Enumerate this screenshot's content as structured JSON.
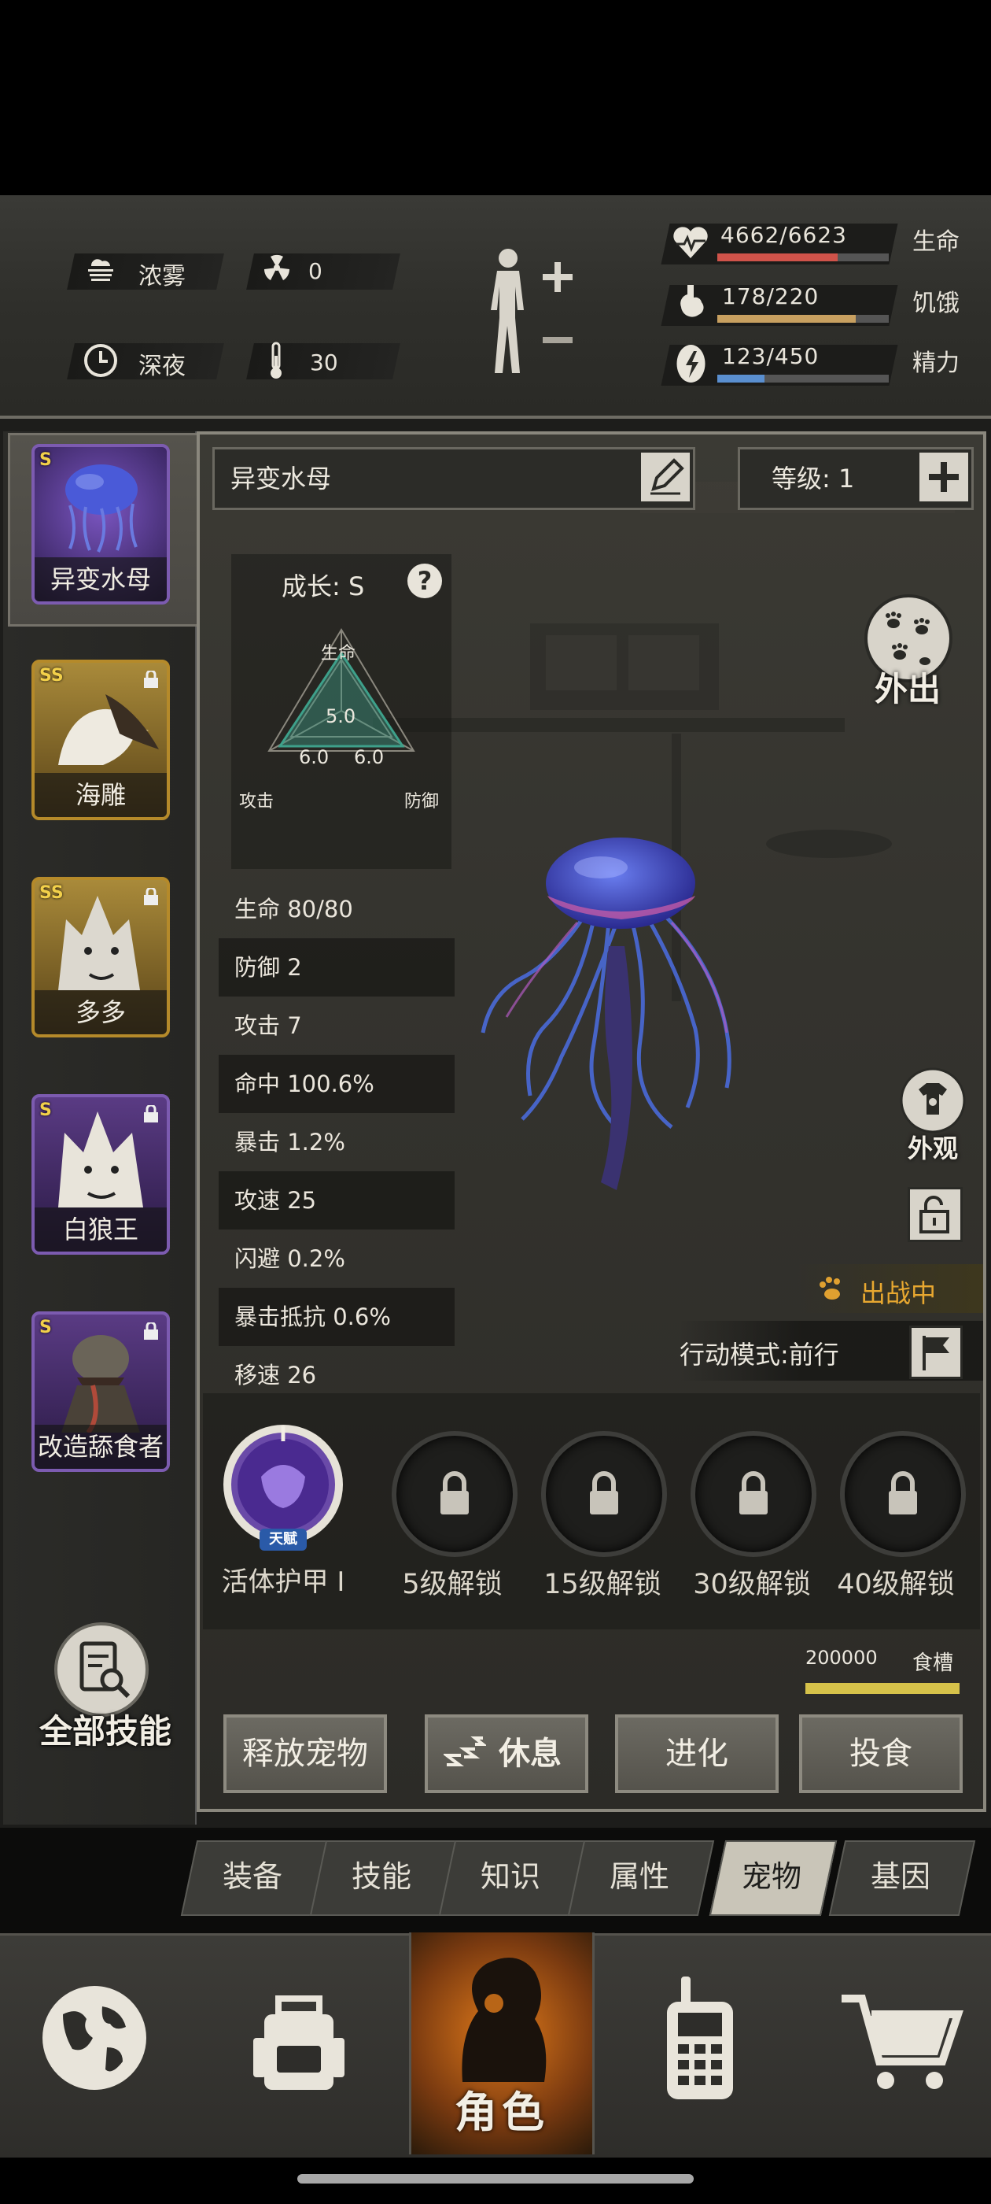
{
  "environment": {
    "weather": "浓雾",
    "radiation": "0",
    "time_of_day": "深夜",
    "temperature": "30"
  },
  "vitals": {
    "health": {
      "text": "4662/6623",
      "label": "生命",
      "ratio": 0.704,
      "color": "#d0534a"
    },
    "hunger": {
      "text": "178/220",
      "label": "饥饿",
      "ratio": 0.809,
      "color": "#c8a060"
    },
    "energy": {
      "text": "123/450",
      "label": "精力",
      "ratio": 0.273,
      "color": "#5a8fd0"
    }
  },
  "pets": [
    {
      "rank": "S",
      "name": "异变水母",
      "locked": false,
      "selected": true,
      "bg": "#5a3b84"
    },
    {
      "rank": "SS",
      "name": "海雕",
      "locked": true,
      "selected": false,
      "bg": "#8a6a2a"
    },
    {
      "rank": "SS",
      "name": "多多",
      "locked": true,
      "selected": false,
      "bg": "#8a6a2a"
    },
    {
      "rank": "S",
      "name": "白狼王",
      "locked": true,
      "selected": false,
      "bg": "#5a3b84"
    },
    {
      "rank": "S",
      "name": "改造舔食者",
      "locked": true,
      "selected": false,
      "bg": "#5a3b84"
    }
  ],
  "all_skills_label": "全部技能",
  "pet_detail": {
    "name": "异变水母",
    "level_label": "等级: 1",
    "growth_label": "成长: S",
    "radar": {
      "axes": [
        "生命",
        "攻击",
        "防御"
      ],
      "values": [
        "5.0",
        "6.0",
        "6.0"
      ]
    },
    "stats": [
      "生命 80/80",
      "防御 2",
      "攻击 7",
      "命中 100.6%",
      "暴击 1.2%",
      "攻速 25",
      "闪避 0.2%",
      "暴击抵抗 0.6%",
      "移速 26"
    ],
    "go_out_label": "外出",
    "appearance_label": "外观",
    "status_label": "出战中",
    "action_mode_label": "行动模式:前行",
    "talent_badge": "天赋",
    "talent_roman": "I",
    "skills": [
      {
        "label": "活体护甲 I",
        "locked": false
      },
      {
        "label": "5级解锁",
        "locked": true
      },
      {
        "label": "15级解锁",
        "locked": true
      },
      {
        "label": "30级解锁",
        "locked": true
      },
      {
        "label": "40级解锁",
        "locked": true
      }
    ],
    "food_amount": "200000",
    "food_label": "食槽",
    "food_ratio": 1.0,
    "buttons": [
      "释放宠物",
      "休息",
      "进化",
      "投食"
    ]
  },
  "tabs": [
    {
      "label": "装备",
      "active": false
    },
    {
      "label": "技能",
      "active": false
    },
    {
      "label": "知识",
      "active": false
    },
    {
      "label": "属性",
      "active": false
    },
    {
      "label": "宠物",
      "active": true
    },
    {
      "label": "基因",
      "active": false
    }
  ],
  "nav": {
    "items": [
      "globe-icon",
      "backpack-icon",
      "character-icon",
      "radio-icon",
      "cart-icon"
    ],
    "active_label": "角色"
  }
}
